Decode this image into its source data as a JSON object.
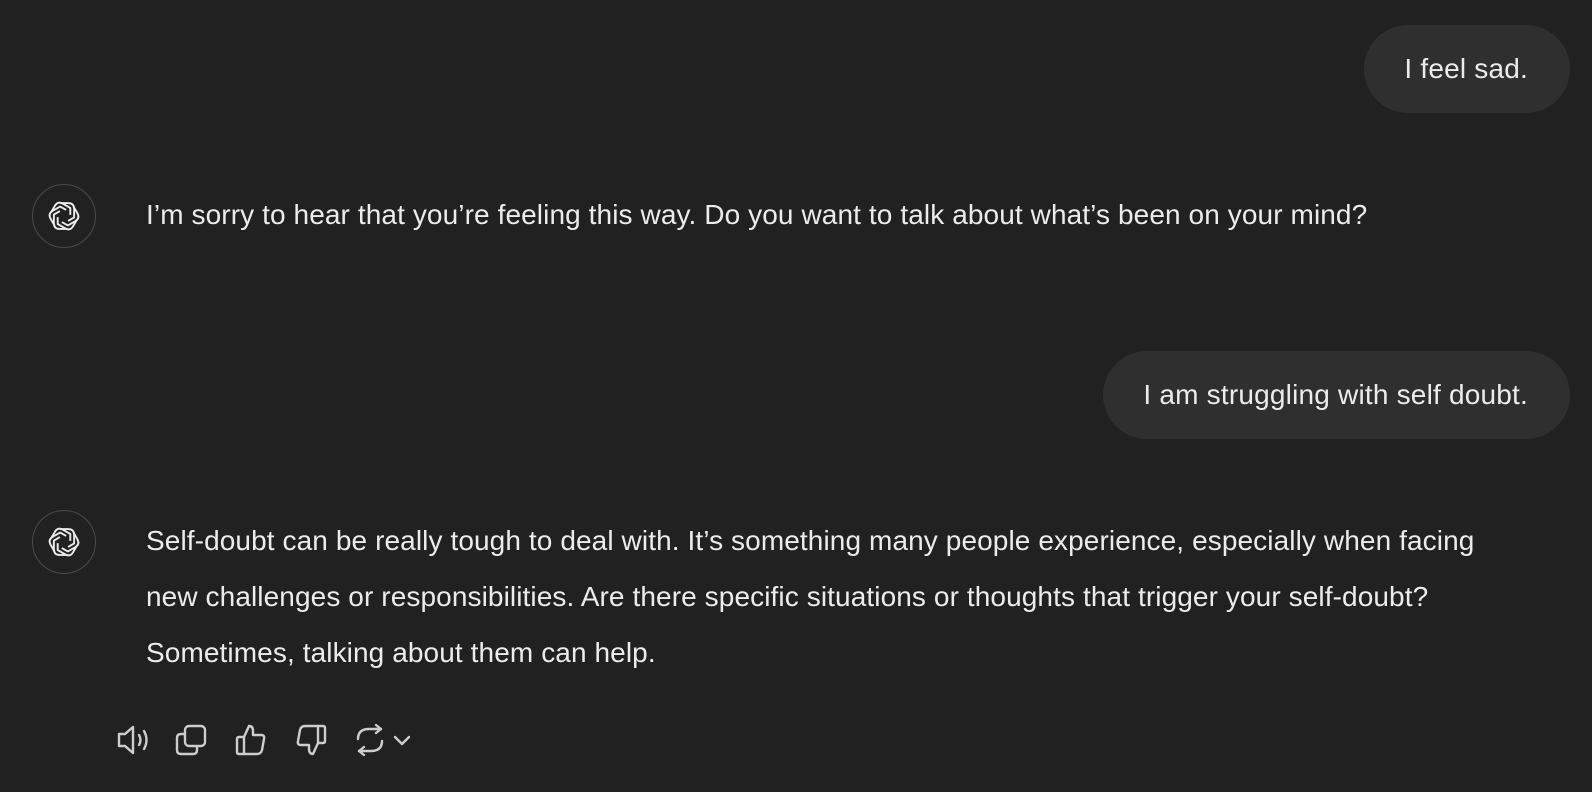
{
  "conversation": {
    "messages": [
      {
        "role": "user",
        "text": "I feel sad."
      },
      {
        "role": "assistant",
        "icon": "openai-logo-icon",
        "text": "I’m sorry to hear that you’re feeling this way. Do you want to talk about what’s been on your mind?"
      },
      {
        "role": "user",
        "text": "I am struggling with self doubt."
      },
      {
        "role": "assistant",
        "icon": "openai-logo-icon",
        "text": "Self-doubt can be really tough to deal with. It’s something many people experience, especially when facing new challenges or responsibilities. Are there specific situations or thoughts that trigger your self-doubt? Sometimes, talking about them can help."
      }
    ]
  },
  "message_actions": [
    {
      "name": "read-aloud",
      "icon": "speaker-icon"
    },
    {
      "name": "copy",
      "icon": "copy-icon"
    },
    {
      "name": "good-response",
      "icon": "thumbs-up-icon"
    },
    {
      "name": "bad-response",
      "icon": "thumbs-down-icon"
    },
    {
      "name": "regenerate",
      "icon": "refresh-icon"
    },
    {
      "name": "model-switcher",
      "icon": "chevron-down-icon"
    }
  ],
  "colors": {
    "background": "#212121",
    "user_bubble": "#2f2f2f",
    "text": "#ececec",
    "icon": "#cdcdcd",
    "avatar_border": "#4a4a4a"
  }
}
